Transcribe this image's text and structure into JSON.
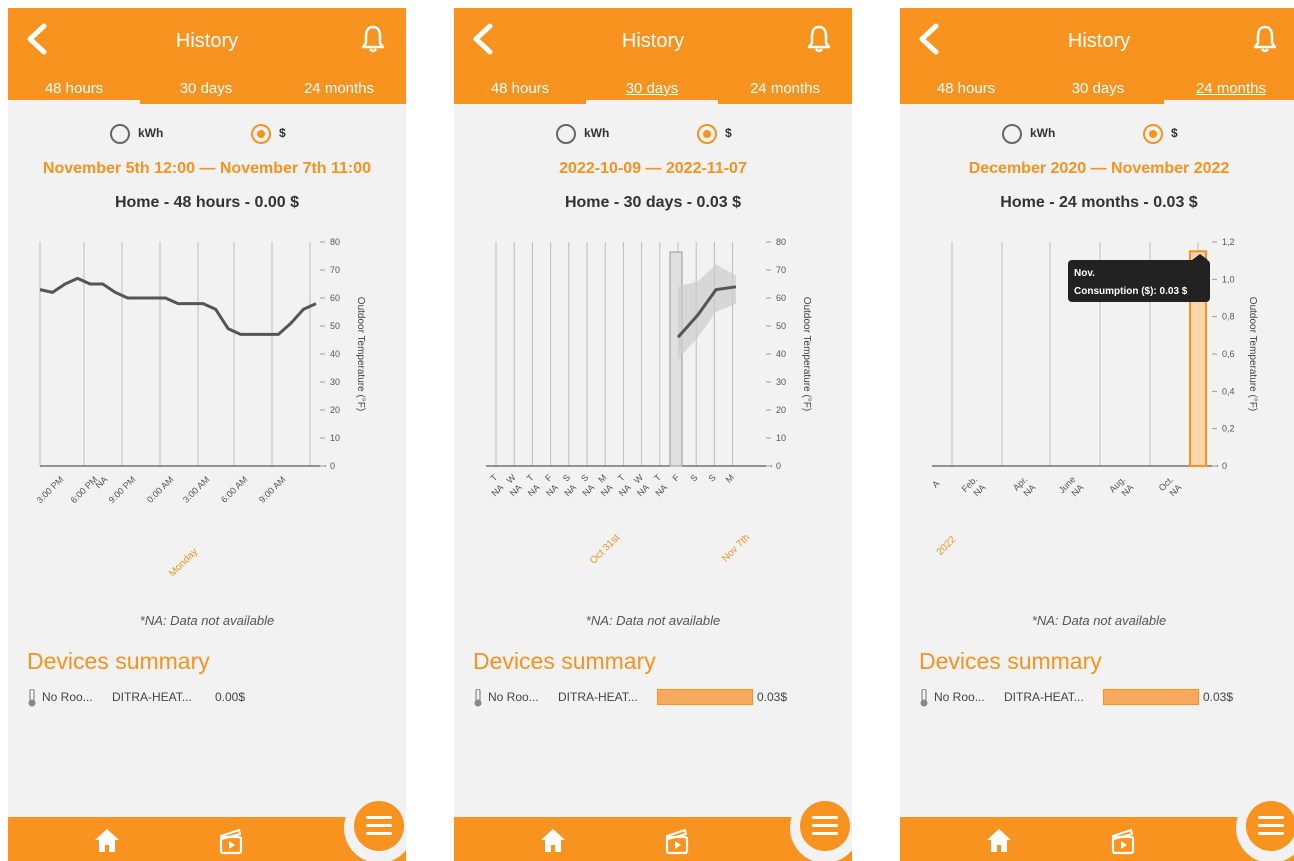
{
  "colors": {
    "accent": "#f7931e",
    "bar": "#f7a95c",
    "line": "#555555",
    "band": "#cccccc"
  },
  "icons": {
    "back": "chevron-left-icon",
    "bell": "bell-icon",
    "home": "home-icon",
    "video": "video-icon",
    "menu": "hamburger-menu-icon",
    "device": "thermometer-icon"
  },
  "panels": [
    {
      "header": {
        "title": "History"
      },
      "tabs": [
        {
          "label": "48 hours"
        },
        {
          "label": "30 days"
        },
        {
          "label": "24 months"
        }
      ],
      "active_tab": 0,
      "radios": {
        "kwh": "kWh",
        "dollar": "$",
        "selected": "$"
      },
      "date_range": "November 5th 12:00 — November 7th 11:00",
      "subtitle": "Home - 48 hours - 0.00 $",
      "note": "*NA: Data not available",
      "devices_title": "Devices summary",
      "device": {
        "room": "No Roo...",
        "name": "DITRA-HEAT...",
        "value": "0.00$",
        "share": 0
      }
    },
    {
      "header": {
        "title": "History"
      },
      "tabs": [
        {
          "label": "48 hours"
        },
        {
          "label": "30 days"
        },
        {
          "label": "24 months"
        }
      ],
      "active_tab": 1,
      "radios": {
        "kwh": "kWh",
        "dollar": "$",
        "selected": "$"
      },
      "date_range": "2022-10-09 — 2022-11-07",
      "subtitle": "Home - 30 days - 0.03 $",
      "note": "*NA: Data not available",
      "devices_title": "Devices summary",
      "device": {
        "room": "No Roo...",
        "name": "DITRA-HEAT...",
        "value": "0.03$",
        "share": 1
      }
    },
    {
      "header": {
        "title": "History"
      },
      "tabs": [
        {
          "label": "48 hours"
        },
        {
          "label": "30 days"
        },
        {
          "label": "24 months"
        }
      ],
      "active_tab": 2,
      "radios": {
        "kwh": "kWh",
        "dollar": "$",
        "selected": "$"
      },
      "date_range": "December 2020 — November 2022",
      "subtitle": "Home - 24 months - 0.03 $",
      "note": "*NA: Data not available",
      "devices_title": "Devices summary",
      "device": {
        "room": "No Roo...",
        "name": "DITRA-HEAT...",
        "value": "0.03$",
        "share": 1
      }
    }
  ],
  "chart_data": [
    {
      "type": "line",
      "y_right_label": "Outdoor Temperature (°F)",
      "ylim": [
        0,
        80
      ],
      "yticks": [
        "0",
        "10",
        "20",
        "30",
        "40",
        "50",
        "60",
        "70",
        "80"
      ],
      "x_ticks": [
        "3:00 PM",
        "6:00 PM",
        "NA",
        "9:00 PM",
        "0:00 AM",
        "3:00 AM",
        "6:00 AM",
        "9:00 AM"
      ],
      "group_labels": [
        "Monday"
      ],
      "series": [
        {
          "values": [
            63,
            62,
            65,
            67,
            65,
            65,
            62,
            60,
            60,
            60,
            60,
            58,
            58,
            58,
            56,
            49,
            47,
            47,
            47,
            47,
            51,
            56,
            58
          ]
        }
      ]
    },
    {
      "type": "bar",
      "y_right_label": "Outdoor Temperature (°F)",
      "ylim": [
        0,
        80
      ],
      "yticks": [
        "0",
        "10",
        "20",
        "30",
        "40",
        "50",
        "60",
        "70",
        "80"
      ],
      "day_ticks": [
        "T",
        "W",
        "T",
        "F",
        "S",
        "S",
        "M",
        "T",
        "W",
        "T",
        "F",
        "S",
        "S",
        "M"
      ],
      "na_ticks": [
        "NA",
        "NA",
        "NA",
        "NA",
        "NA",
        "NA",
        "NA",
        "NA",
        "NA",
        "NA"
      ],
      "group_labels": [
        "Oct 31st",
        "Nov 7th"
      ],
      "consumption_bar": {
        "category": "T",
        "value": 0.03
      },
      "series": [
        {
          "values": [
            46,
            54,
            63,
            64
          ]
        }
      ],
      "band": {
        "upper": [
          64,
          66,
          72,
          68
        ],
        "lower": [
          38,
          46,
          55,
          58
        ]
      }
    },
    {
      "type": "bar",
      "y_label": "Consumption ($)",
      "y_right_label": "Outdoor Temperature (°F)",
      "ylim": [
        0,
        1.2
      ],
      "yticks": [
        "0",
        "0,2",
        "0,4",
        "0,6",
        "0,8",
        "1,0",
        "1,2"
      ],
      "x_ticks": [
        "Feb.",
        "Apr.",
        "June",
        "Aug.",
        "Oct."
      ],
      "na_ticks": [
        "NA",
        "NA",
        "NA",
        "NA",
        "NA"
      ],
      "first_tick": "A",
      "group_labels": [
        "2022"
      ],
      "tooltip": {
        "title": "Nov.",
        "text": "Consumption ($): 0.03 $"
      },
      "bars": [
        {
          "category": "Nov.",
          "value": 0.03
        }
      ]
    }
  ]
}
